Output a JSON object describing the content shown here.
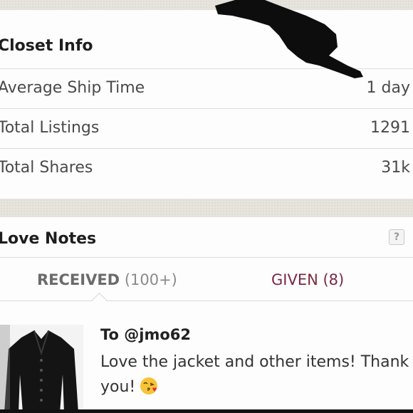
{
  "closet_info": {
    "title": "Closet Info",
    "rows": [
      {
        "label": "Average Ship Time",
        "value": "1 day"
      },
      {
        "label": "Total Listings",
        "value": "1291"
      },
      {
        "label": "Total Shares",
        "value": "31k"
      }
    ]
  },
  "love_notes": {
    "title": "Love Notes",
    "help_label": "?",
    "tabs": {
      "received_label": "RECEIVED",
      "received_count": "(100+)",
      "given_label": "GIVEN (8)"
    },
    "note": {
      "to": "To @jmo62",
      "text": "Love the jacket and other items! Thank you!"
    }
  },
  "colors": {
    "accent_given": "#7a2a43",
    "background_band": "#e7e4de"
  },
  "icons": {
    "pointer": "pointing-hand-icon",
    "emoji": "kissing-face-emoji-icon",
    "help": "question-mark-icon"
  }
}
